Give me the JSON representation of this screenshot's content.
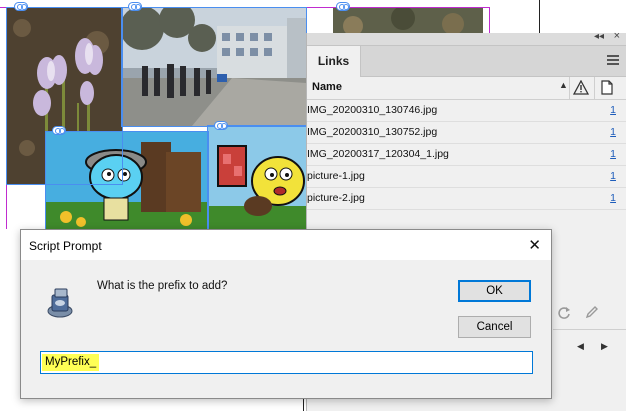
{
  "links_panel": {
    "tab_label": "Links",
    "column_name": "Name",
    "sort_indicator": "▲",
    "links": [
      {
        "name": "IMG_20200310_130746.jpg",
        "page": "1"
      },
      {
        "name": "IMG_20200310_130752.jpg",
        "page": "1"
      },
      {
        "name": "IMG_20200317_120304_1.jpg",
        "page": "1"
      },
      {
        "name": "picture-1.jpg",
        "page": "1"
      },
      {
        "name": "picture-2.jpg",
        "page": "1"
      }
    ],
    "collapse_glyph": "◂◂",
    "close_glyph": "×",
    "nav_prev_glyph": "◀",
    "nav_next_glyph": "▶"
  },
  "dialog": {
    "title": "Script Prompt",
    "close_glyph": "✕",
    "prompt": "What is the prefix to add?",
    "ok_label": "OK",
    "cancel_label": "Cancel",
    "input_value": "MyPrefix_"
  },
  "colors": {
    "selection_blue": "#4a8ef0",
    "frame_magenta": "#c02ccf",
    "input_highlight": "#ffff55",
    "link_blue": "#1e5dbb"
  }
}
